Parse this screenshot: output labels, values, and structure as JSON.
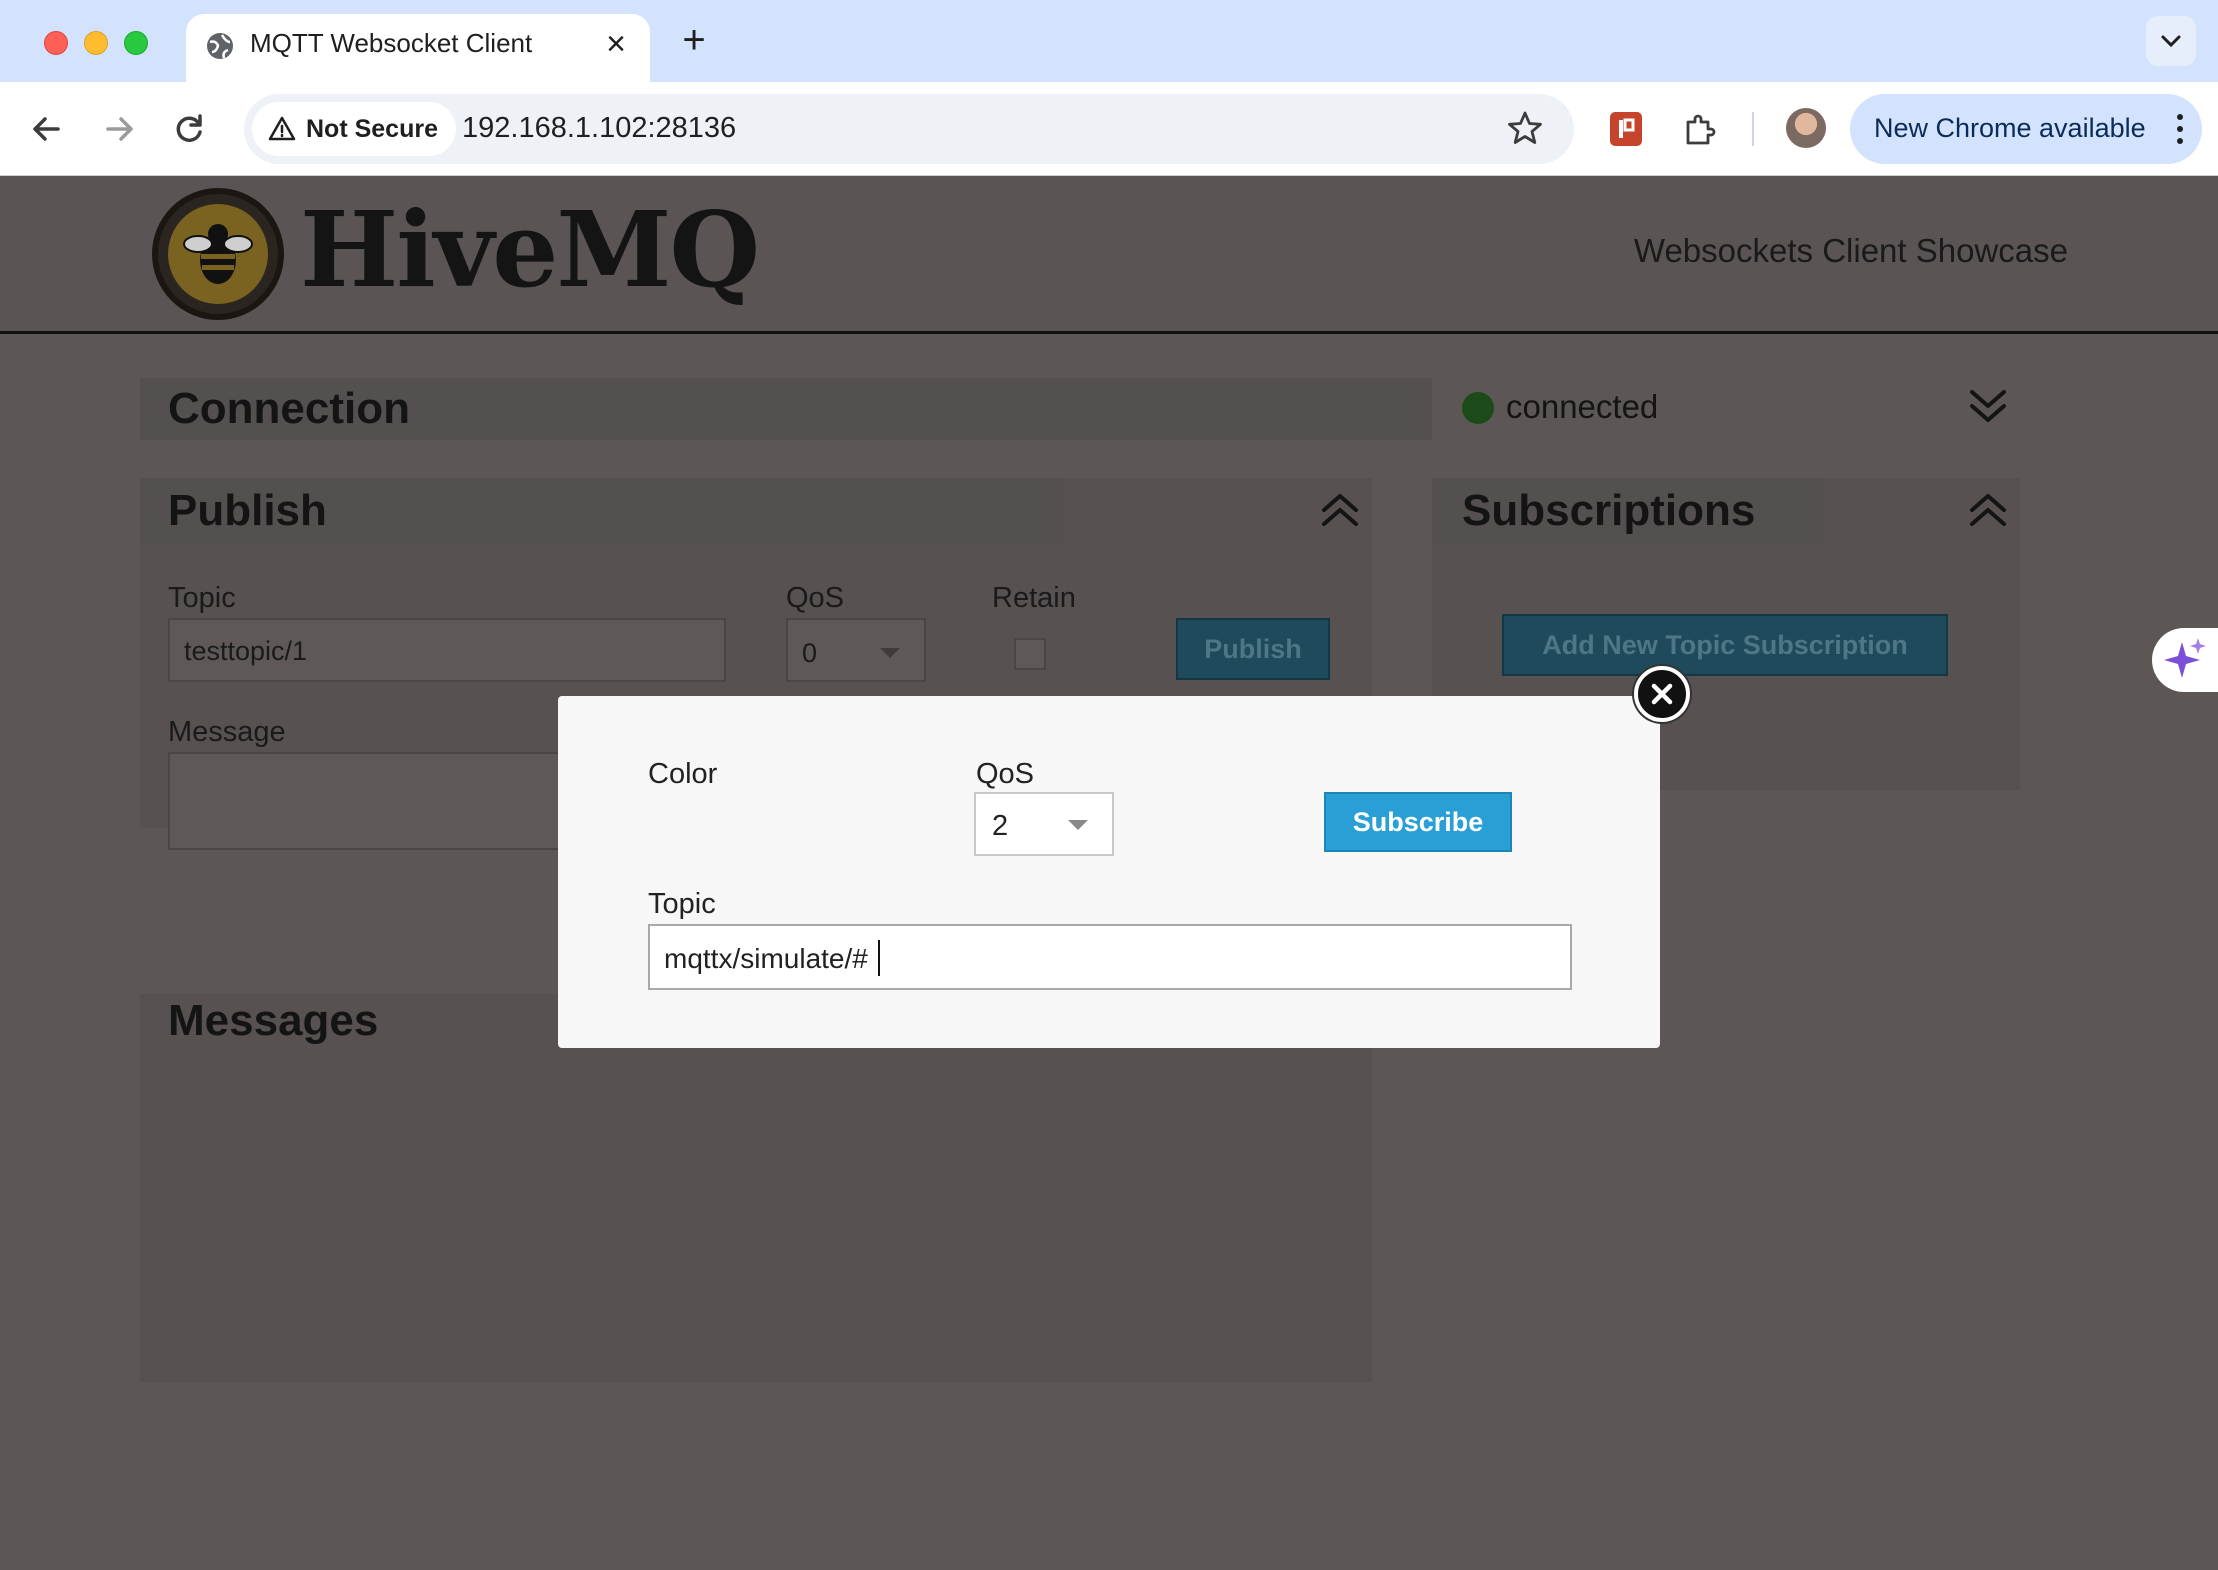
{
  "browser": {
    "tab_title": "MQTT Websocket Client",
    "new_tab_label": "+",
    "tab_close_label": "×",
    "security_label": "Not Secure",
    "url": "192.168.1.102:28136",
    "update_label": "New Chrome available"
  },
  "header": {
    "logo_text": "HiveMQ",
    "subtitle": "Websockets Client Showcase"
  },
  "connection": {
    "title": "Connection",
    "status": "connected",
    "status_color": "#1c4a18"
  },
  "publish": {
    "title": "Publish",
    "topic_label": "Topic",
    "topic_value": "testtopic/1",
    "qos_label": "QoS",
    "qos_value": "0",
    "retain_label": "Retain",
    "publish_button": "Publish",
    "message_label": "Message"
  },
  "subscriptions": {
    "title": "Subscriptions",
    "add_button": "Add New Topic Subscription"
  },
  "messages": {
    "title": "Messages"
  },
  "modal": {
    "color_label": "Color",
    "qos_label": "QoS",
    "qos_value": "2",
    "subscribe_button": "Subscribe",
    "topic_label": "Topic",
    "topic_value": "mqttx/simulate/#",
    "accent_color": "#2a9fd6"
  }
}
